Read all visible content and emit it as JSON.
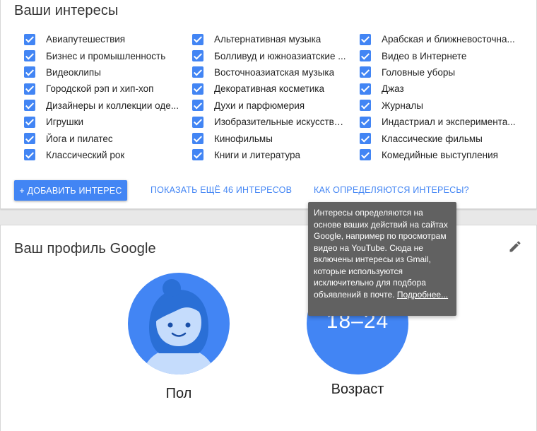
{
  "interests": {
    "title": "Ваши интересы",
    "items": [
      "Авиапутешествия",
      "Бизнес и промышленность",
      "Видеоклипы",
      "Городской рэп и хип-хоп",
      "Дизайнеры и коллекции оде...",
      "Игрушки",
      "Йога и пилатес",
      "Классический рок",
      "Альтернативная музыка",
      "Болливуд и южноазиатские ...",
      "Восточноазиатская музыка",
      "Декоративная косметика",
      "Духи и парфюмерия",
      "Изобразительные искусства ...",
      "Кинофильмы",
      "Книги и литература",
      "Арабская и ближневосточна...",
      "Видео в Интернете",
      "Головные уборы",
      "Джаз",
      "Журналы",
      "Индастриал и эксперимента...",
      "Классические фильмы",
      "Комедийные выступления"
    ],
    "add_button": "+ ДОБАВИТЬ ИНТЕРЕС",
    "show_more": "ПОКАЗАТЬ ЕЩЁ 46 ИНТЕРЕСОВ",
    "how_determined": "КАК ОПРЕДЕЛЯЮТСЯ ИНТЕРЕСЫ?"
  },
  "tooltip": {
    "text": "Интересы определяются на основе ваших действий на сайтах Google, например по просмотрам видео на YouTube. Сюда не включены интересы из Gmail, которые используются исключительно для подбора объявлений в почте.",
    "link": "Подробнее..."
  },
  "profile": {
    "title": "Ваш профиль Google",
    "gender_label": "Пол",
    "age_label": "Возраст",
    "age_value": "18–24"
  },
  "colors": {
    "accent": "#4285f4",
    "tooltip_bg": "#616161"
  }
}
